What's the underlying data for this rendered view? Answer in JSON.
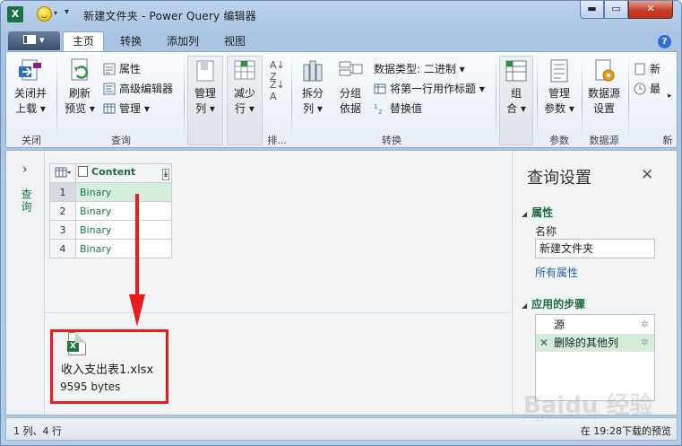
{
  "window": {
    "app_badge": "X",
    "title": "新建文件夹 - Power Query 编辑器",
    "min": "▬",
    "max": "▭",
    "close": "✕"
  },
  "ribbon": {
    "file_tab": "",
    "tabs": [
      "主页",
      "转换",
      "添加列",
      "视图"
    ],
    "active_tab": "主页",
    "help": "?",
    "groups": {
      "close": {
        "label": "关闭",
        "close_load": [
          "关闭并",
          "上载 ▾"
        ]
      },
      "query": {
        "label": "查询",
        "refresh": [
          "刷新",
          "预览 ▾"
        ],
        "properties": "属性",
        "advanced_editor": "高级编辑器",
        "manage": "管理 ▾"
      },
      "manage_cols": {
        "manage": [
          "管理",
          "列 ▾"
        ]
      },
      "reduce_rows": {
        "reduce": [
          "减少",
          "行 ▾"
        ]
      },
      "sort": {
        "label": "排..."
      },
      "transform": {
        "label": "转换",
        "split": [
          "拆分",
          "列 ▾"
        ],
        "group": [
          "分组",
          "依据"
        ],
        "data_type": "数据类型: 二进制 ▾",
        "first_row_header": "将第一行用作标题 ▾",
        "replace": "替换值"
      },
      "combine": {
        "combine": [
          "组",
          "合 ▾"
        ]
      },
      "params": {
        "label": "参数",
        "manage": [
          "管理",
          "参数 ▾"
        ]
      },
      "datasource": {
        "label": "数据源",
        "settings": [
          "数据源",
          "设置"
        ]
      },
      "new": {
        "label": "新",
        "new_source": "新",
        "recent": "最"
      }
    }
  },
  "left_pane": {
    "chevron": "›",
    "label": "查询"
  },
  "table": {
    "column": "Content",
    "rows": [
      {
        "num": "1",
        "value": "Binary"
      },
      {
        "num": "2",
        "value": "Binary"
      },
      {
        "num": "3",
        "value": "Binary"
      },
      {
        "num": "4",
        "value": "Binary"
      }
    ]
  },
  "preview": {
    "file_name": "收入支出表1.xlsx",
    "file_size": "9595 bytes",
    "icon_badge": "X"
  },
  "query_settings": {
    "title": "查询设置",
    "close": "✕",
    "properties_header": "属性",
    "name_label": "名称",
    "name_value": "新建文件夹",
    "all_properties": "所有属性",
    "steps_header": "应用的步骤",
    "steps": [
      {
        "label": "源",
        "selected": false
      },
      {
        "label": "删除的其他列",
        "selected": true
      }
    ]
  },
  "status": {
    "left": "1 列、4 行",
    "right": "在 19:28下载的预览"
  },
  "watermark": {
    "main": "Baidu 经验",
    "sub": "jingyan.baidu.com"
  },
  "colors": {
    "accent_green": "#1e7b47",
    "highlight_red": "#e81d1d",
    "link_blue": "#2962a8"
  }
}
